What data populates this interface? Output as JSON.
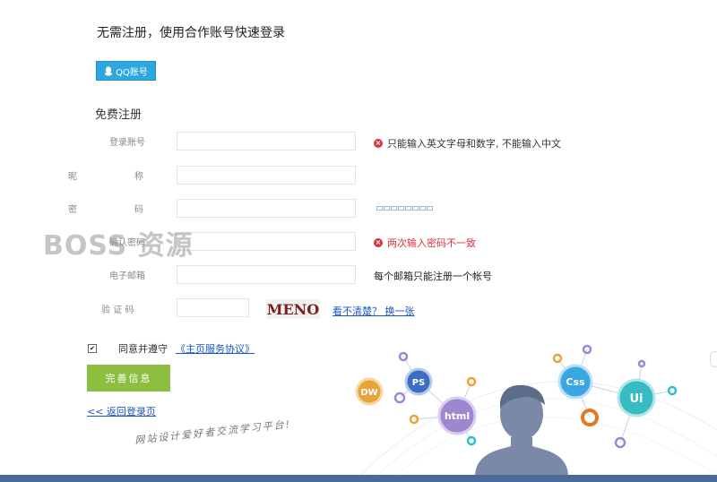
{
  "quick_login": {
    "title": "无需注册，使用合作账号快速登录",
    "qq_button": "QQ账号"
  },
  "register": {
    "title": "免费注册",
    "fields": {
      "account": {
        "label": "登录账号",
        "error": "只能输入英文字母和数字, 不能输入中文"
      },
      "nickname": {
        "label_a": "昵",
        "label_b": "称"
      },
      "password": {
        "label_a": "密",
        "label_b": "码"
      },
      "confirm": {
        "label": "确认密码",
        "error": "两次输入密码不一致"
      },
      "email": {
        "label": "电子邮箱",
        "hint": "每个邮箱只能注册一个帐号"
      },
      "captcha": {
        "label": "验 证 码",
        "image_text": "MENO",
        "refresh_link": "看不清楚？ 换一张"
      }
    },
    "agree": {
      "checked": true,
      "text": "同意并遵守",
      "link": "《主页服务协议》"
    },
    "submit_label": "完善信息",
    "back_link": "<< 返回登录页"
  },
  "watermark": "BOSS 资源",
  "slogan": "网站设计爱好者交流学习平台!",
  "illustration": {
    "badges": [
      "DW",
      "PS",
      "html",
      "Css",
      "Ui"
    ],
    "colors": {
      "dw": "#e8a33a",
      "ps": "#3b6dc1",
      "html": "#9f87cf",
      "css": "#3aa6e2",
      "ui": "#38bcc4",
      "person": "#7a8aa6"
    }
  },
  "colors": {
    "qq": "#2ea7e0",
    "submit": "#8cbf3f",
    "error": "#d9343e",
    "link": "#1a55c7",
    "bar": "#4a6a97"
  }
}
